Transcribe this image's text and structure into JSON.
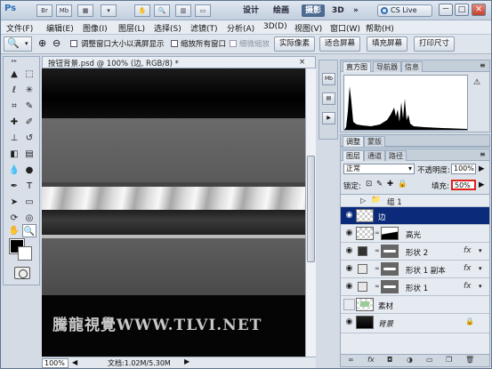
{
  "titlebar": {
    "app_logo": "Ps",
    "buttons": [
      "Br",
      "Mb"
    ],
    "workspaces": [
      "设计",
      "绘画",
      "摄影",
      "3D"
    ],
    "active_workspace": "摄影",
    "more": "»",
    "cslive": "CS Live",
    "window_controls": [
      "－",
      "□",
      "✕"
    ]
  },
  "menu": [
    "文件(F)",
    "编辑(E)",
    "图像(I)",
    "图层(L)",
    "选择(S)",
    "滤镜(T)",
    "分析(A)",
    "3D(D)",
    "视图(V)",
    "窗口(W)",
    "帮助(H)"
  ],
  "options": {
    "resize_windows": "调整窗口大小以满屏显示",
    "zoom_all": "缩放所有窗口",
    "scrubby_zoom": "细微缩放",
    "actual_pixels": "实际像素",
    "fit_screen": "适合屏幕",
    "fill_screen": "填充屏幕",
    "print_size": "打印尺寸"
  },
  "document": {
    "tab_title": "按钮背景.psd @ 100% (边, RGB/8) *",
    "close": "×",
    "zoom": "100%",
    "doc_info": "文档:1.02M/5.30M",
    "watermark": "騰龍視覺WWW.TLVI.NET"
  },
  "histogram_panel": {
    "tabs": [
      "直方图",
      "导航器",
      "信息"
    ]
  },
  "adjust_panel": {
    "tabs": [
      "调整",
      "蒙版"
    ]
  },
  "layers_panel": {
    "tabs": [
      "图层",
      "通道",
      "路径"
    ],
    "blend_mode": "正常",
    "opacity_label": "不透明度:",
    "opacity": "100%",
    "lock_label": "锁定:",
    "fill_label": "填充:",
    "fill": "50%",
    "layers": [
      {
        "name": "组 1",
        "type": "group"
      },
      {
        "name": "边",
        "type": "pixel",
        "selected": true
      },
      {
        "name": "高光",
        "type": "pixel"
      },
      {
        "name": "形状 2",
        "type": "shape",
        "fx": "fx"
      },
      {
        "name": "形状 1 副本",
        "type": "shape",
        "fx": "fx"
      },
      {
        "name": "形状 1",
        "type": "shape",
        "fx": "fx"
      },
      {
        "name": "素材",
        "type": "pixel",
        "visible": false
      },
      {
        "name": "背景",
        "type": "background"
      }
    ],
    "footer_icons": [
      "link-icon",
      "fx-icon",
      "mask-icon",
      "adjustment-icon",
      "folder-icon",
      "new-layer-icon",
      "trash-icon"
    ]
  },
  "colors": {
    "selected_layer": "#0b2b7a",
    "active_workspace": "#4c6a92",
    "fill_highlight": "#e0201a"
  }
}
